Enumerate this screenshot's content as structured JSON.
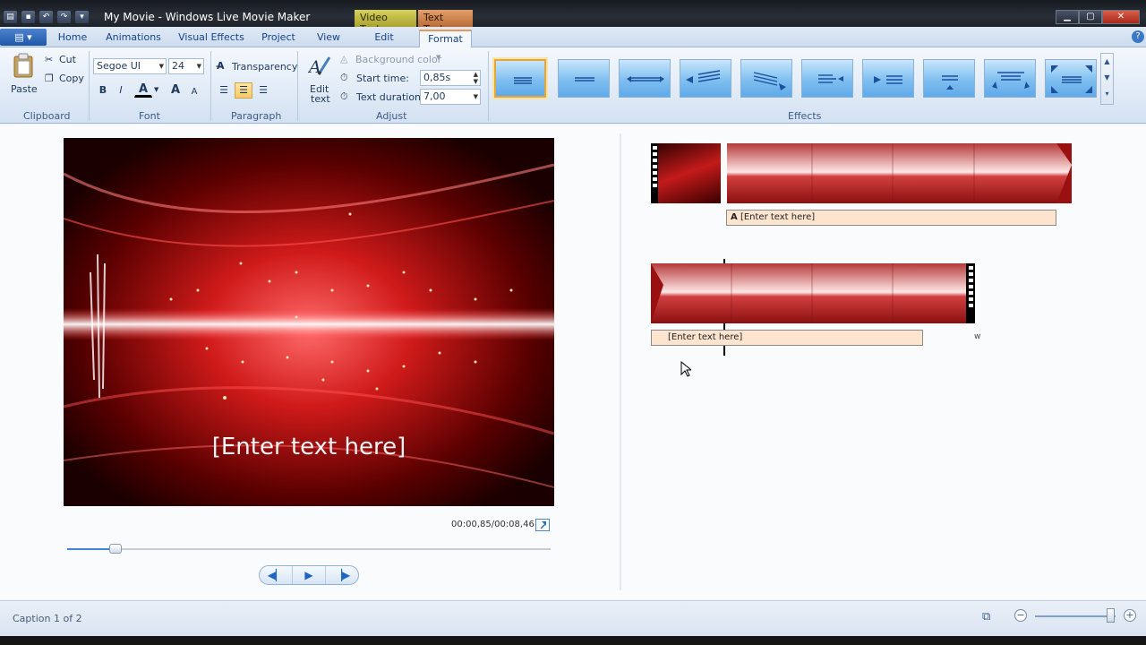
{
  "window": {
    "title": "My Movie - Windows Live Movie Maker",
    "context_tabs": {
      "video_tools": "Video Tools",
      "text_tools": "Text Tools"
    }
  },
  "tabs": [
    {
      "label": "Home"
    },
    {
      "label": "Animations"
    },
    {
      "label": "Visual Effects"
    },
    {
      "label": "Project"
    },
    {
      "label": "View"
    },
    {
      "label": "Edit"
    },
    {
      "label": "Format",
      "active": true
    }
  ],
  "ribbon": {
    "clipboard": {
      "paste": "Paste",
      "cut": "Cut",
      "copy": "Copy",
      "group": "Clipboard"
    },
    "font": {
      "family": "Segoe UI",
      "size": "24",
      "bold": "B",
      "italic": "I",
      "color": "A",
      "grow": "A",
      "shrink": "A",
      "group": "Font"
    },
    "paragraph": {
      "transparency": "Transparency",
      "group": "Paragraph"
    },
    "adjust": {
      "edit_text_1": "Edit",
      "edit_text_2": "text",
      "background_color": "Background color",
      "start_time_label": "Start time:",
      "start_time_value": "0,85s",
      "text_duration_label": "Text duration:",
      "text_duration_value": "7,00",
      "group": "Adjust"
    },
    "effects": {
      "group": "Effects",
      "items": [
        "none",
        "cinematic",
        "scroll",
        "fly-in-left",
        "fly-in-right",
        "zoom",
        "swing",
        "stretch",
        "rise",
        "wave",
        "expand"
      ],
      "selected_index": 0
    }
  },
  "preview": {
    "overlay_text": "[Enter text here]",
    "time_readout": "00:00,85/00:08,46",
    "seek_fraction": 0.1,
    "transport": {
      "previous": "◀▏",
      "play": "▶",
      "next": "▕▶"
    }
  },
  "storyboard": {
    "caption_1": "[Enter text here]",
    "caption_1_icon": "A",
    "caption_2": "[Enter text here]",
    "marker": "w"
  },
  "status": {
    "text": "Caption 1 of 2",
    "zoom_fraction": 0.93
  },
  "colors": {
    "accent": "#e89a55",
    "clip_red": "#c41a1a",
    "caption_bg": "#fce4cf"
  }
}
